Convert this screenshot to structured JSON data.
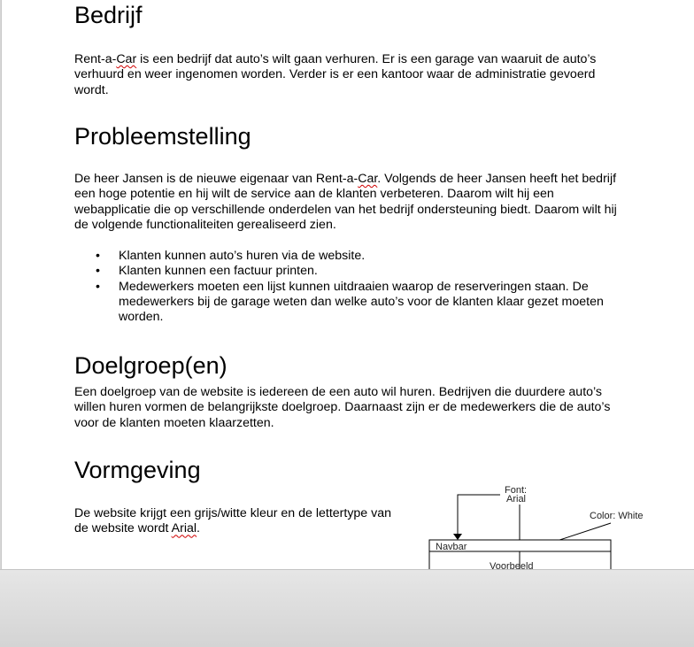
{
  "sections": {
    "bedrijf": {
      "heading": "Bedrijf",
      "p1": "Rent-a-",
      "p1_spell": "Car",
      "p1_rest": " is een bedrijf dat auto’s wilt gaan verhuren. Er is een garage van waaruit de auto’s verhuurd en weer ingenomen worden. Verder is er een kantoor waar de administratie gevoerd wordt."
    },
    "probleemstelling": {
      "heading": "Probleemstelling",
      "p1": "De heer Jansen is de nieuwe eigenaar van Rent-a-",
      "p1_spell": "Car",
      "p1_rest": ". Volgends de heer Jansen heeft het bedrijf een hoge potentie en hij wilt de service aan de klanten verbeteren. Daarom wilt hij een webapplicatie die op verschillende onderdelen van het bedrijf ondersteuning biedt. Daarom wilt hij de volgende functionaliteiten gerealiseerd zien.",
      "bullets": [
        "Klanten kunnen auto’s huren via de website.",
        "Klanten kunnen een factuur printen.",
        "Medewerkers moeten een lijst kunnen uitdraaien waarop de reserveringen staan. De medewerkers bij de garage weten dan welke auto’s voor de klanten klaar gezet moeten worden."
      ]
    },
    "doelgroep": {
      "heading": "Doelgroep(en)",
      "p1": "Een doelgroep van de website is iedereen de een auto wil huren. Bedrijven die duurdere auto’s willen huren vormen de belangrijkste doelgroep. Daarnaast zijn er de medewerkers die de auto’s voor de klanten moeten klaarzetten."
    },
    "vormgeving": {
      "heading": "Vormgeving",
      "p1": "De website krijgt een grijs/witte kleur en de lettertype van de website wordt ",
      "p1_spell": "Arial",
      "p1_rest": "."
    }
  },
  "diagram": {
    "font_label_1": "Font:",
    "font_label_2": "Arial",
    "color_label": "Color: White",
    "navbar_label": "Navbar",
    "voorbeeld_label": "Voorbeeld"
  }
}
